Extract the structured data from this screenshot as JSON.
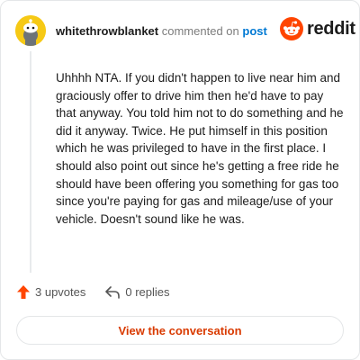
{
  "comment": {
    "username": "whitethrowblanket",
    "action_text": "commented on",
    "target_link": "post",
    "body": "Uhhhh NTA. If you didn't happen to live near him and graciously offer to drive him then he'd have to pay that anyway. You told him not to do something and he did it anyway. Twice. He put himself in this position which he was privileged to have in the first place. I should also point out since he's getting a free ride he should have been offering you something for gas too since you're paying for gas and mileage/use of your vehicle. Doesn't sound like he was."
  },
  "brand": {
    "wordmark": "reddit",
    "icon": "reddit-snoo-icon",
    "color": "#ff4500"
  },
  "stats": {
    "upvotes_label": "3 upvotes",
    "upvote_icon": "upvote-arrow-icon",
    "upvote_color": "#ff4500",
    "replies_label": "0 replies",
    "reply_icon": "reply-arrow-icon"
  },
  "cta": {
    "label": "View the conversation",
    "color": "#d93a00"
  }
}
